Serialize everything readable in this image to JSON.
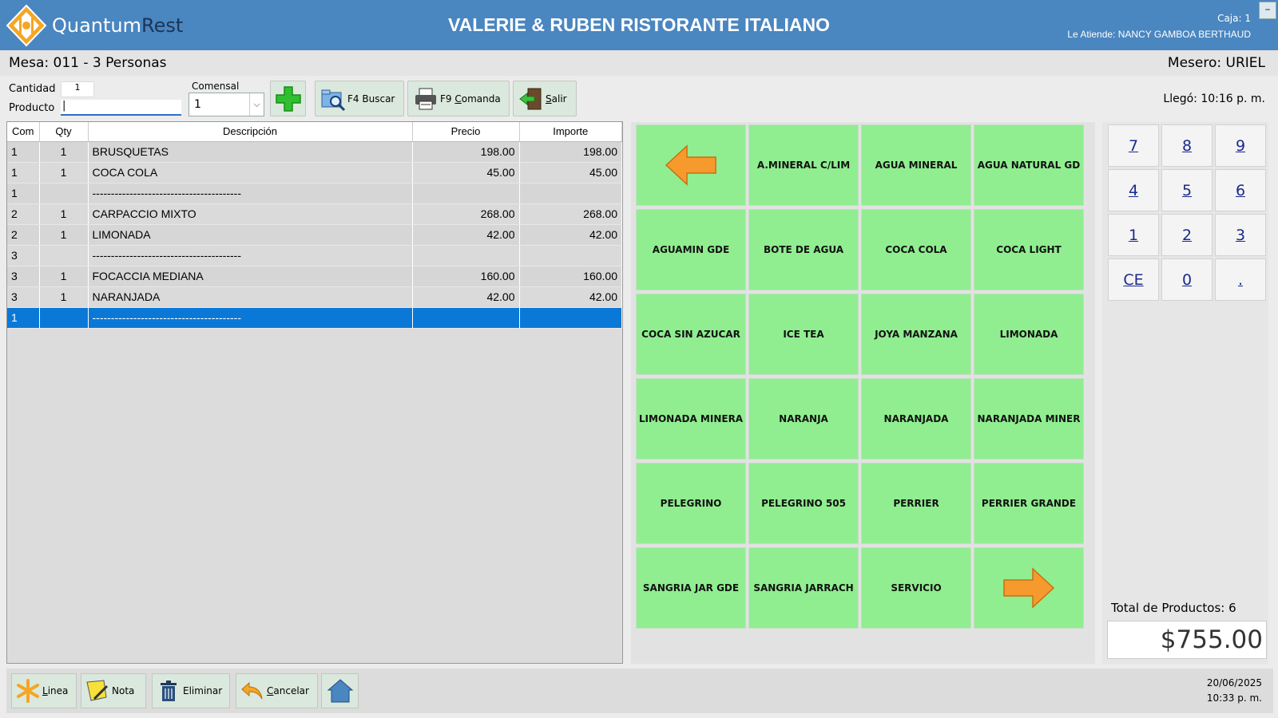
{
  "header": {
    "brand_a": "Quantum",
    "brand_b": "Rest",
    "restaurant": "VALERIE & RUBEN RISTORANTE ITALIANO",
    "caja": "Caja: 1",
    "atiende": "Le Atiende: NANCY GAMBOA BERTHAUD",
    "minimize": "–"
  },
  "subbar": {
    "mesa": "Mesa: 011 - 3 Personas",
    "mesero": "Mesero: URIEL"
  },
  "form": {
    "cantidad_label": "Cantidad",
    "cantidad_value": "1",
    "producto_label": "Producto",
    "producto_value": "|",
    "comensal_label": "Comensal",
    "comensal_value": "1",
    "llego": "Llegó: 10:16 p. m."
  },
  "toolbar": {
    "buscar_key": "F4",
    "buscar": "Buscar",
    "comanda_key": "F9",
    "comanda_first": "C",
    "comanda_rest": "omanda",
    "salir_first": "S",
    "salir_rest": "alir"
  },
  "table": {
    "headers": [
      "Com",
      "Qty",
      "Descripción",
      "Precio",
      "Importe"
    ],
    "rows": [
      {
        "com": "1",
        "qty": "1",
        "desc": "BRUSQUETAS",
        "precio": "198.00",
        "importe": "198.00"
      },
      {
        "com": "1",
        "qty": "1",
        "desc": "COCA COLA",
        "precio": "45.00",
        "importe": "45.00"
      },
      {
        "com": "1",
        "qty": "",
        "desc": "----------------------------------------",
        "precio": "",
        "importe": ""
      },
      {
        "com": "2",
        "qty": "1",
        "desc": "CARPACCIO MIXTO",
        "precio": "268.00",
        "importe": "268.00"
      },
      {
        "com": "2",
        "qty": "1",
        "desc": "LIMONADA",
        "precio": "42.00",
        "importe": "42.00"
      },
      {
        "com": "3",
        "qty": "",
        "desc": "----------------------------------------",
        "precio": "",
        "importe": ""
      },
      {
        "com": "3",
        "qty": "1",
        "desc": "FOCACCIA MEDIANA",
        "precio": "160.00",
        "importe": "160.00"
      },
      {
        "com": "3",
        "qty": "1",
        "desc": "NARANJADA",
        "precio": "42.00",
        "importe": "42.00"
      },
      {
        "com": "1",
        "qty": "",
        "desc": "----------------------------------------",
        "precio": "",
        "importe": ""
      }
    ],
    "selected_row": 8
  },
  "products": [
    "A.MINERAL C/LIM",
    "AGUA MINERAL",
    "AGUA NATURAL GD",
    "AGUAMIN GDE",
    "BOTE DE AGUA",
    "COCA COLA",
    "COCA LIGHT",
    "COCA SIN AZUCAR",
    "ICE TEA",
    "JOYA MANZANA",
    "LIMONADA",
    "LIMONADA MINERA",
    "NARANJA",
    "NARANJADA",
    "NARANJADA MINER",
    "PELEGRINO",
    "PELEGRINO 505",
    "PERRIER",
    "PERRIER GRANDE",
    "SANGRIA JAR GDE",
    "SANGRIA JARRACH",
    "SERVICIO"
  ],
  "numpad": [
    "7",
    "8",
    "9",
    "4",
    "5",
    "6",
    "1",
    "2",
    "3",
    "CE",
    "0",
    "."
  ],
  "totals": {
    "label": "Total de Productos: 6",
    "amount": "$755.00"
  },
  "bottom": {
    "linea_first": "L",
    "linea_rest": "inea",
    "nota": "Nota",
    "eliminar": "Eliminar",
    "cancelar_first": "C",
    "cancelar_rest": "ancelar",
    "date": "20/06/2025",
    "time": "10:33 p. m."
  },
  "colors": {
    "header": "#4a86c0",
    "product_button": "#90ee90",
    "selected_row": "#0a78d7",
    "arrow": "#f79a2e"
  }
}
